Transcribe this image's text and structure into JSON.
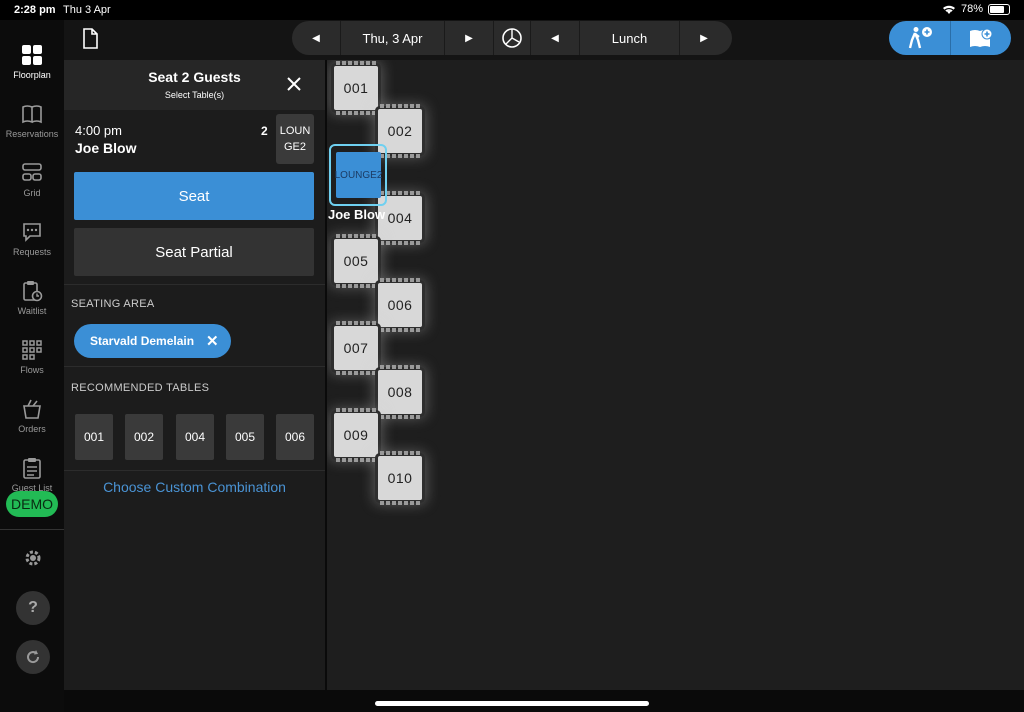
{
  "status_bar": {
    "time": "2:28 pm",
    "date": "Thu 3 Apr",
    "battery": "78%"
  },
  "nav": {
    "items": [
      {
        "label": "Floorplan",
        "icon": "floorplan-icon",
        "active": true
      },
      {
        "label": "Reservations",
        "icon": "book-icon",
        "active": false
      },
      {
        "label": "Grid",
        "icon": "grid-icon",
        "active": false
      },
      {
        "label": "Requests",
        "icon": "chat-icon",
        "active": false
      },
      {
        "label": "Waitlist",
        "icon": "clipboard-clock-icon",
        "active": false
      },
      {
        "label": "Flows",
        "icon": "flows-icon",
        "active": false
      },
      {
        "label": "Orders",
        "icon": "takeaway-icon",
        "active": false
      },
      {
        "label": "Guest List",
        "icon": "guest-list-icon",
        "active": false
      }
    ],
    "demo_badge": "DEMO",
    "help_label": "?"
  },
  "topbar": {
    "date_label": "Thu, 3 Apr",
    "service_label": "Lunch",
    "accent": "#3b8fd6"
  },
  "panel": {
    "title": "Seat 2 Guests",
    "subtitle": "Select Table(s)",
    "reservation": {
      "time": "4:00 pm",
      "guest": "Joe Blow",
      "party_size": "2",
      "table": "LOUNGE2"
    },
    "seat_label": "Seat",
    "seat_partial_label": "Seat Partial",
    "seating_area_heading": "SEATING AREA",
    "seating_area_chip": "Starvald Demelain",
    "recommended_heading": "RECOMMENDED TABLES",
    "recommended_tables": [
      "001",
      "002",
      "004",
      "005",
      "006"
    ],
    "custom_combination_label": "Choose Custom Combination"
  },
  "floorplan": {
    "tables": [
      "001",
      "002",
      "004",
      "005",
      "006",
      "007",
      "008",
      "009",
      "010"
    ],
    "selected_table": "LOUNGE2",
    "selected_guest": "Joe Blow"
  }
}
